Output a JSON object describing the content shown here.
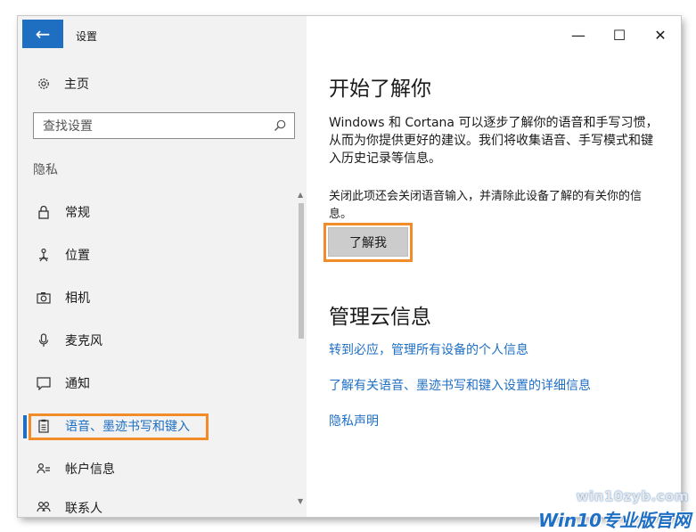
{
  "window": {
    "title": "设置",
    "back_glyph": "←",
    "minimize_glyph": "—",
    "maximize_glyph": "☐",
    "close_glyph": "✕"
  },
  "sidebar": {
    "home_label": "主页",
    "search_placeholder": "查找设置",
    "section_label": "隐私",
    "items": [
      {
        "label": "常规",
        "icon": "lock-icon"
      },
      {
        "label": "位置",
        "icon": "location-person-icon"
      },
      {
        "label": "相机",
        "icon": "camera-icon"
      },
      {
        "label": "麦克风",
        "icon": "microphone-icon"
      },
      {
        "label": "通知",
        "icon": "notification-icon"
      },
      {
        "label": "语音、墨迹书写和键入",
        "icon": "clipboard-icon",
        "selected": true
      },
      {
        "label": "帐户信息",
        "icon": "account-info-icon"
      },
      {
        "label": "联系人",
        "icon": "contacts-icon"
      }
    ]
  },
  "main": {
    "heading1": "开始了解你",
    "paragraph1": "Windows 和 Cortana 可以逐步了解你的语音和手写习惯，从而为你提供更好的建议。我们将收集语音、手写模式和键入历史记录等信息。",
    "paragraph2": "关闭此项还会关闭语音输入，并清除此设备了解的有关你的信息。",
    "button_label": "了解我",
    "heading2": "管理云信息",
    "links": [
      "转到必应，管理所有设备的个人信息",
      "了解有关语音、墨迹书写和键入设置的详细信息",
      "隐私声明"
    ]
  },
  "watermark": {
    "url": "win10zyb.com",
    "brand": "Win10专业版官网"
  },
  "colors": {
    "accent": "#1e6fc2",
    "highlight": "#f28c28",
    "link": "#1f6fc4"
  }
}
